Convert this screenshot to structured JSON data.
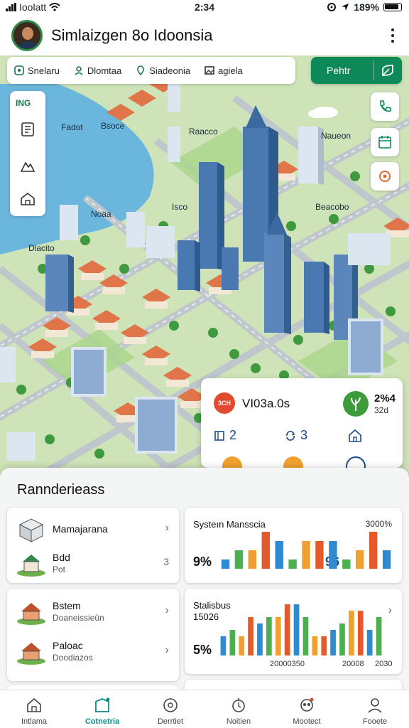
{
  "status": {
    "left": "Ioolatt",
    "time": "2:34",
    "battery": "189%"
  },
  "header": {
    "title": "Simlaizgen 8o Idoonsia"
  },
  "filters": [
    {
      "label": "Snelaru",
      "icon": "chat-square-icon"
    },
    {
      "label": "Dlomtaa",
      "icon": "person-icon"
    },
    {
      "label": "Siadeonia",
      "icon": "location-pin-icon"
    },
    {
      "label": "agiela",
      "icon": "image-icon"
    }
  ],
  "primary_button": {
    "label": "Pehtr",
    "icon": "leaf-icon"
  },
  "toolpanel": {
    "label": "ING"
  },
  "map_labels": [
    {
      "text": "Fadot"
    },
    {
      "text": "Bsoce"
    },
    {
      "text": "Raacco"
    },
    {
      "text": "Naueon"
    },
    {
      "text": "Noaa"
    },
    {
      "text": "Isco"
    },
    {
      "text": "Beacobo"
    },
    {
      "text": "Dlacito"
    }
  ],
  "info_card": {
    "badge": "3CH",
    "name": "VI03a.0s",
    "n1": "2%4",
    "n2": "32d",
    "stat1": "2",
    "stat2": "3"
  },
  "sheet": {
    "title": "Rannderieass",
    "list_a": [
      {
        "t1": "Mamajarana",
        "t2": ""
      },
      {
        "t1": "Bdd",
        "t2": "Pot",
        "trail": "3"
      }
    ],
    "list_b": [
      {
        "t1": "Bstem",
        "t2": "Doaneissieün"
      },
      {
        "t1": "Paloac",
        "t2": "Doodiazos"
      }
    ],
    "chart1": {
      "title": "Systeın Mansscia",
      "right": "3000%",
      "left_value": "9%",
      "mid_value": "96"
    },
    "chart2": {
      "title": "Stalisbus",
      "sub": "15026",
      "left_value": "5%",
      "foot1": "20000350",
      "foot2": "20008",
      "foot3": "2030"
    }
  },
  "chart_data": [
    {
      "type": "bar",
      "title": "Systeın Mansscia",
      "series": [
        {
          "values": [
            1,
            2,
            2,
            4,
            3,
            1,
            3,
            3,
            3,
            1,
            2,
            4,
            2
          ]
        }
      ],
      "colors": [
        "#2f8ad0",
        "#4caf50",
        "#f0a030",
        "#e45a2a"
      ],
      "ylim": [
        0,
        4
      ]
    },
    {
      "type": "bar",
      "title": "Stalisbus",
      "series": [
        {
          "values": [
            3,
            4,
            3,
            6,
            5,
            6,
            6,
            8,
            8,
            6,
            3,
            3,
            4,
            5,
            7,
            7,
            4,
            6
          ]
        }
      ],
      "colors": [
        "#2f8ad0",
        "#4caf50",
        "#f0a030",
        "#e45a2a"
      ],
      "ylim": [
        0,
        8
      ]
    }
  ],
  "nav": [
    {
      "label": "Intlama",
      "icon": "home-icon"
    },
    {
      "label": "Cotnetria",
      "icon": "map-icon",
      "active": true
    },
    {
      "label": "Derrtiet",
      "icon": "clock-icon"
    },
    {
      "label": "Noitien",
      "icon": "bell-icon"
    },
    {
      "label": "Mootect",
      "icon": "cluster-icon"
    },
    {
      "label": "Fooete",
      "icon": "person-icon"
    }
  ]
}
